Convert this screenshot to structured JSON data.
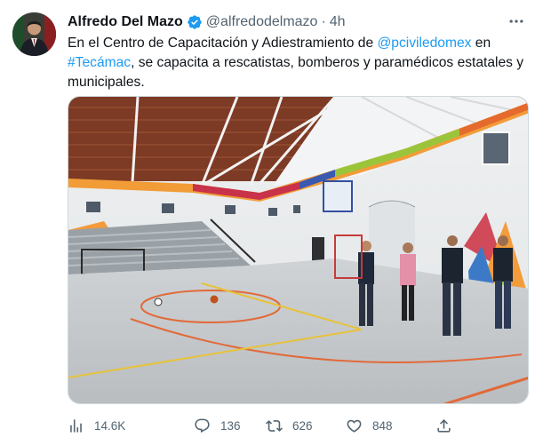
{
  "tweet": {
    "author_name": "Alfredo Del Mazo",
    "handle": "@alfredodelmazo",
    "separator": "·",
    "time": "4h",
    "more_icon": "more-horizontal-icon",
    "verified_icon": "verified-badge-icon",
    "text_parts": {
      "p1": "En el Centro de Capacitación y Adiestramiento de ",
      "mention": "@pciviledomex",
      "p2": " en ",
      "hashtag": "#Tecámac",
      "p3": ", se capacita a rescatistas, bomberos y paramédicos estatales y municipales."
    },
    "link_color": "#1d9bf0"
  },
  "actions": {
    "views": {
      "icon": "analytics-icon",
      "count": "14.6K"
    },
    "reply": {
      "icon": "reply-icon",
      "count": "136"
    },
    "retweet": {
      "icon": "retweet-icon",
      "count": "626"
    },
    "like": {
      "icon": "like-icon",
      "count": "848"
    },
    "share": {
      "icon": "share-icon"
    }
  }
}
